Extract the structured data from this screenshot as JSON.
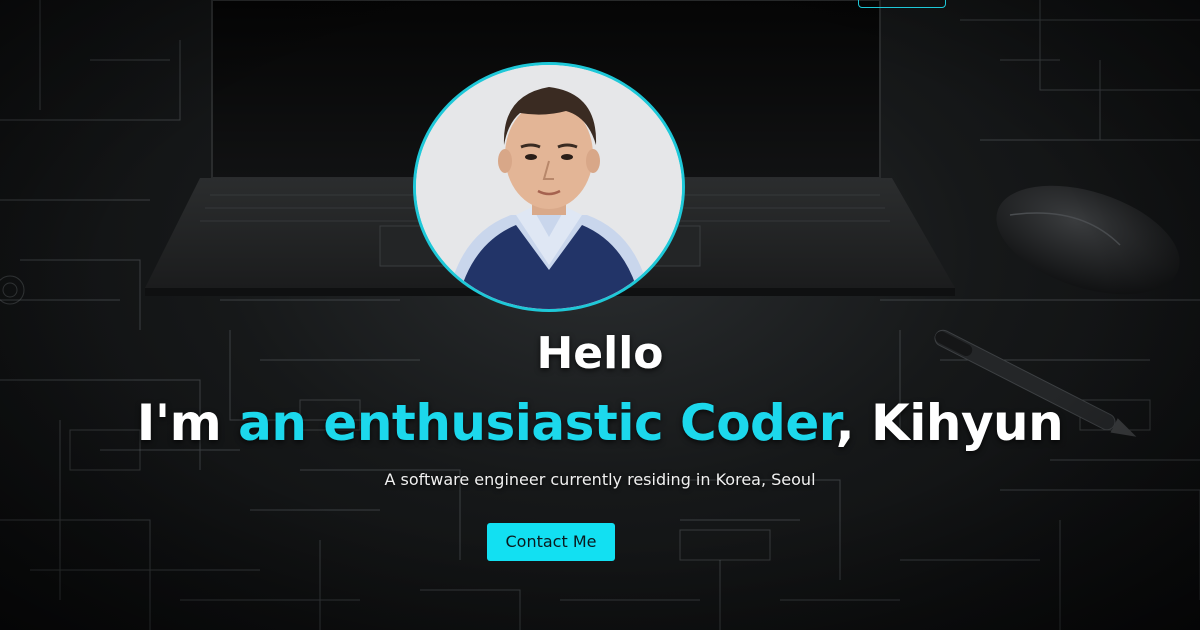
{
  "hero": {
    "hello": "Hello",
    "headline_prefix": "I'm ",
    "headline_accent": "an enthusiastic Coder",
    "headline_suffix": ", Kihyun",
    "subtitle": "A software engineer currently residing in Korea, Seoul",
    "contact_label": "Contact Me"
  },
  "colors": {
    "accent": "#1cd8ec",
    "button": "#12e0f2",
    "avatar_border": "#1ec8d8",
    "text": "#ffffff"
  }
}
